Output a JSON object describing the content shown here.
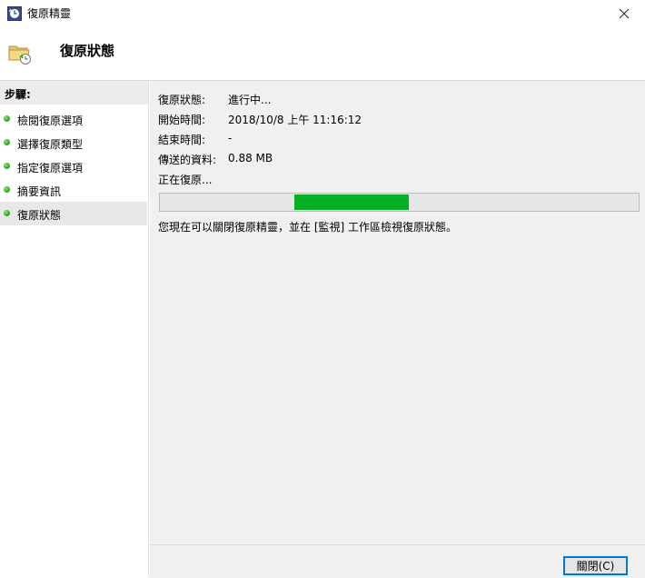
{
  "window": {
    "title": "復原精靈",
    "close_glyph": "✕",
    "app_icon": "recovery-clock-icon"
  },
  "header": {
    "title": "復原狀態",
    "icon": "folder-restore-icon"
  },
  "sidebar": {
    "heading": "步驟:",
    "items": [
      {
        "label": "檢閱復原選項",
        "status": "complete"
      },
      {
        "label": "選擇復原類型",
        "status": "complete"
      },
      {
        "label": "指定復原選項",
        "status": "complete"
      },
      {
        "label": "摘要資訊",
        "status": "complete"
      },
      {
        "label": "復原狀態",
        "status": "active"
      }
    ]
  },
  "status": {
    "fields": [
      {
        "label": "復原狀態:",
        "value": "進行中..."
      },
      {
        "label": "開始時間:",
        "value": "2018/10/8 上午 11:16:12"
      },
      {
        "label": "結束時間:",
        "value": "-"
      },
      {
        "label": "傳送的資料:",
        "value": "0.88 MB"
      }
    ],
    "progress_label": "正在復原...",
    "progress": {
      "indeterminate": true,
      "chunk_start": 0.28,
      "chunk_end": 0.52,
      "color": "#06b025"
    },
    "notice": "您現在可以關閉復原精靈，並在 [監視] 工作區檢視復原狀態。"
  },
  "footer": {
    "close_button": "關閉(C)"
  }
}
